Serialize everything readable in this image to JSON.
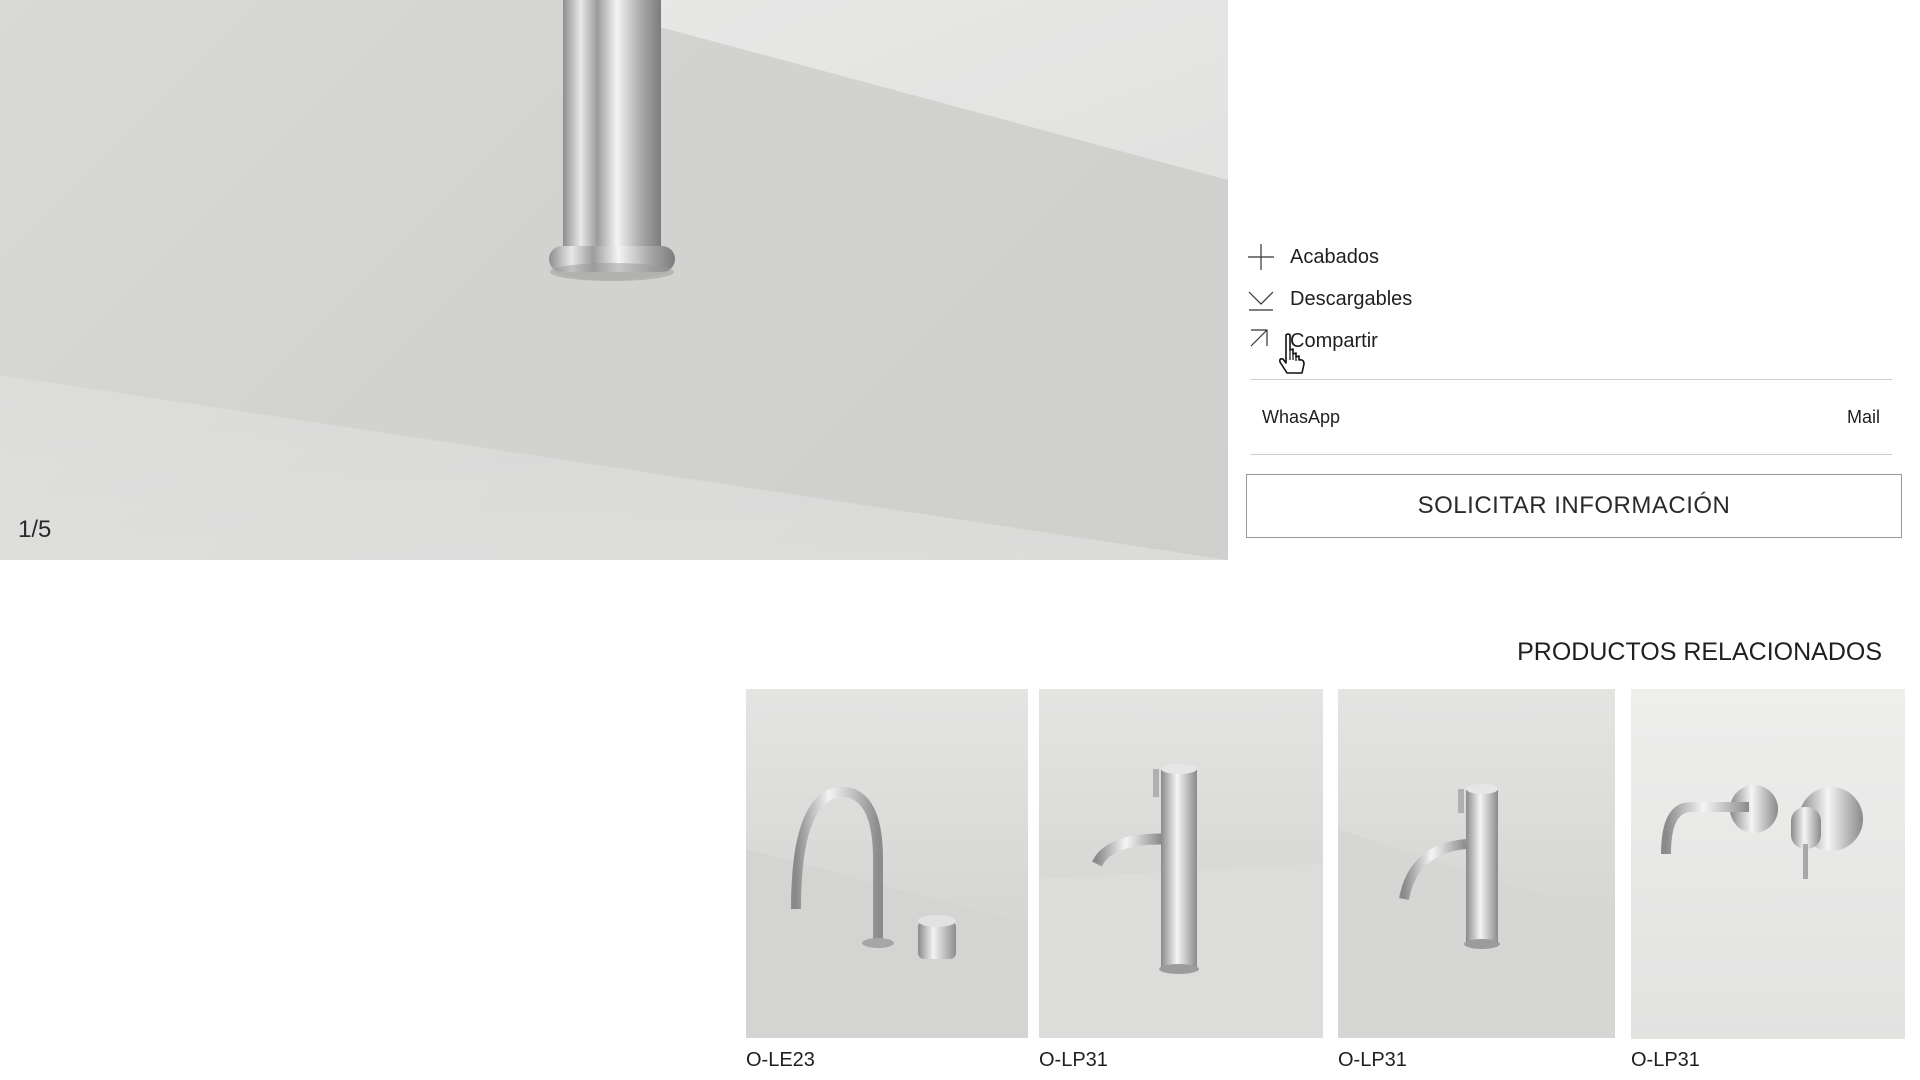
{
  "hero": {
    "counter": "1/5",
    "image_icon": "faucet-photo"
  },
  "actions": [
    {
      "label": "Acabados",
      "icon": "plus-icon"
    },
    {
      "label": "Descargables",
      "icon": "download-icon"
    },
    {
      "label": "Compartir",
      "icon": "arrow-up-left-icon"
    }
  ],
  "share": {
    "whatsapp": "WhasApp",
    "mail": "Mail"
  },
  "request_button": "SOLICITAR INFORMACIÓN",
  "related": {
    "title": "PRODUCTOS RELACIONADOS",
    "items": [
      {
        "name": "O-LE23"
      },
      {
        "name": "O-LP31"
      },
      {
        "name": "O-LP31"
      },
      {
        "name": "O-LP31"
      }
    ]
  },
  "colors": {
    "text": "#1a1a1a",
    "border": "#9a9a9a",
    "divider": "#cfcfcf",
    "chrome": "#c8c8c8"
  }
}
